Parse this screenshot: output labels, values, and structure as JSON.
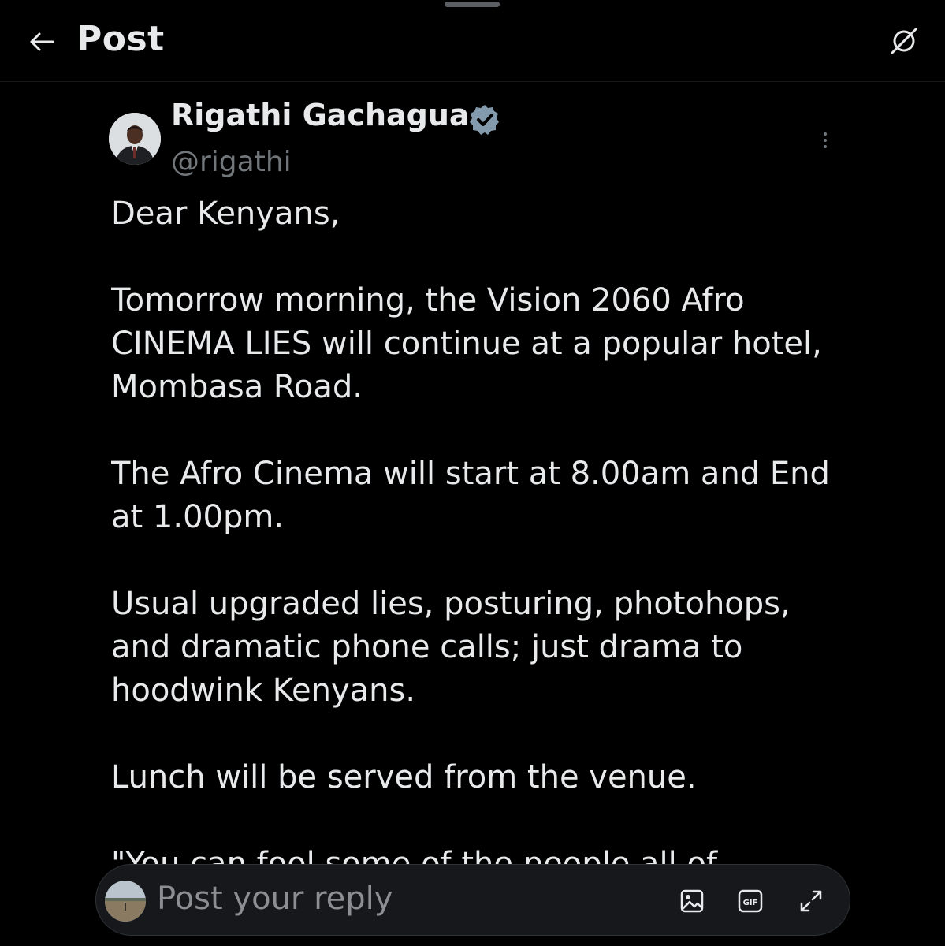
{
  "header": {
    "title": "Post",
    "back_icon": "arrow-left-icon",
    "action_icon": "grok-slash-icon"
  },
  "post": {
    "author_name": "Rigathi Gachagua",
    "handle": "@rigathi",
    "verified": true,
    "verified_color": "#829aab",
    "paragraphs": [
      "Dear Kenyans,",
      "Tomorrow morning, the Vision 2060 Afro CINEMA LIES will continue at a popular hotel, Mombasa Road.",
      "The Afro Cinema will start at 8.00am and End at 1.00pm.",
      "Usual upgraded lies, posturing, photohops, and dramatic phone calls; just drama to hoodwink Kenyans.",
      "Lunch will be served from the venue.",
      "\"You can fool some of the people all of"
    ]
  },
  "reply": {
    "placeholder": "Post your reply",
    "icons": [
      "image-icon",
      "gif-icon",
      "expand-icon"
    ],
    "gif_label": "GIF"
  },
  "colors": {
    "background": "#000000",
    "text": "#e7e9ea",
    "muted": "#71767b"
  }
}
